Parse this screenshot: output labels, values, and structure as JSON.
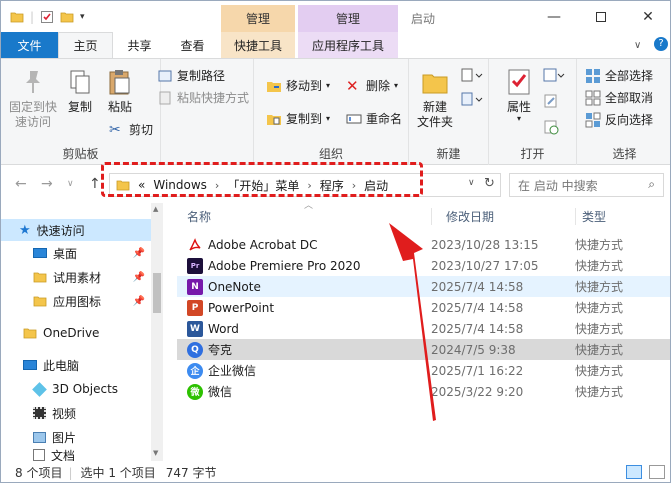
{
  "titlebar": {
    "context_tab_1": "管理",
    "context_tab_2": "管理",
    "title": "启动"
  },
  "tabs": {
    "file": "文件",
    "home": "主页",
    "share": "共享",
    "view": "查看",
    "shortcut_tools": "快捷工具",
    "app_tools": "应用程序工具"
  },
  "ribbon": {
    "clipboard": {
      "pin": "固定到快\n速访问",
      "copy": "复制",
      "paste": "粘贴",
      "copy_path": "复制路径",
      "paste_shortcut": "粘贴快捷方式",
      "cut": "剪切",
      "label": "剪贴板"
    },
    "organize": {
      "move_to": "移动到",
      "copy_to": "复制到",
      "delete": "删除",
      "rename": "重命名",
      "label": "组织"
    },
    "new": {
      "new_folder": "新建\n文件夹",
      "label": "新建"
    },
    "open": {
      "properties": "属性",
      "label": "打开"
    },
    "select": {
      "select_all": "全部选择",
      "select_none": "全部取消",
      "invert": "反向选择",
      "label": "选择"
    }
  },
  "address": {
    "prefix": "«",
    "crumbs": [
      "Windows",
      "「开始」菜单",
      "程序",
      "启动"
    ],
    "search_placeholder": "在 启动 中搜索"
  },
  "navpane": {
    "items": [
      {
        "label": "快速访问"
      },
      {
        "label": "桌面"
      },
      {
        "label": "试用素材"
      },
      {
        "label": "应用图标"
      },
      {
        "label": "OneDrive"
      },
      {
        "label": "此电脑"
      },
      {
        "label": "3D Objects"
      },
      {
        "label": "视频"
      },
      {
        "label": "图片"
      },
      {
        "label": "文档"
      }
    ]
  },
  "list": {
    "columns": [
      "名称",
      "修改日期",
      "类型"
    ],
    "rows": [
      {
        "name": "Adobe Acrobat DC",
        "date": "2023/10/28 13:15",
        "type": "快捷方式"
      },
      {
        "name": "Adobe Premiere Pro 2020",
        "date": "2023/10/27 17:05",
        "type": "快捷方式"
      },
      {
        "name": "OneNote",
        "date": "2025/7/4 14:58",
        "type": "快捷方式"
      },
      {
        "name": "PowerPoint",
        "date": "2025/7/4 14:58",
        "type": "快捷方式"
      },
      {
        "name": "Word",
        "date": "2025/7/4 14:58",
        "type": "快捷方式"
      },
      {
        "name": "夸克",
        "date": "2024/7/5 9:38",
        "type": "快捷方式"
      },
      {
        "name": "企业微信",
        "date": "2025/7/1 16:22",
        "type": "快捷方式"
      },
      {
        "name": "微信",
        "date": "2025/3/22 9:20",
        "type": "快捷方式"
      }
    ]
  },
  "status": {
    "count": "8 个项目",
    "selection": "选中 1 个项目",
    "size": "747 字节"
  },
  "colors": {
    "file_tab": "#1979ca",
    "annotation": "#e01d1d",
    "selected_row": "#d9d9d9",
    "hover_row": "#e5f3ff"
  }
}
